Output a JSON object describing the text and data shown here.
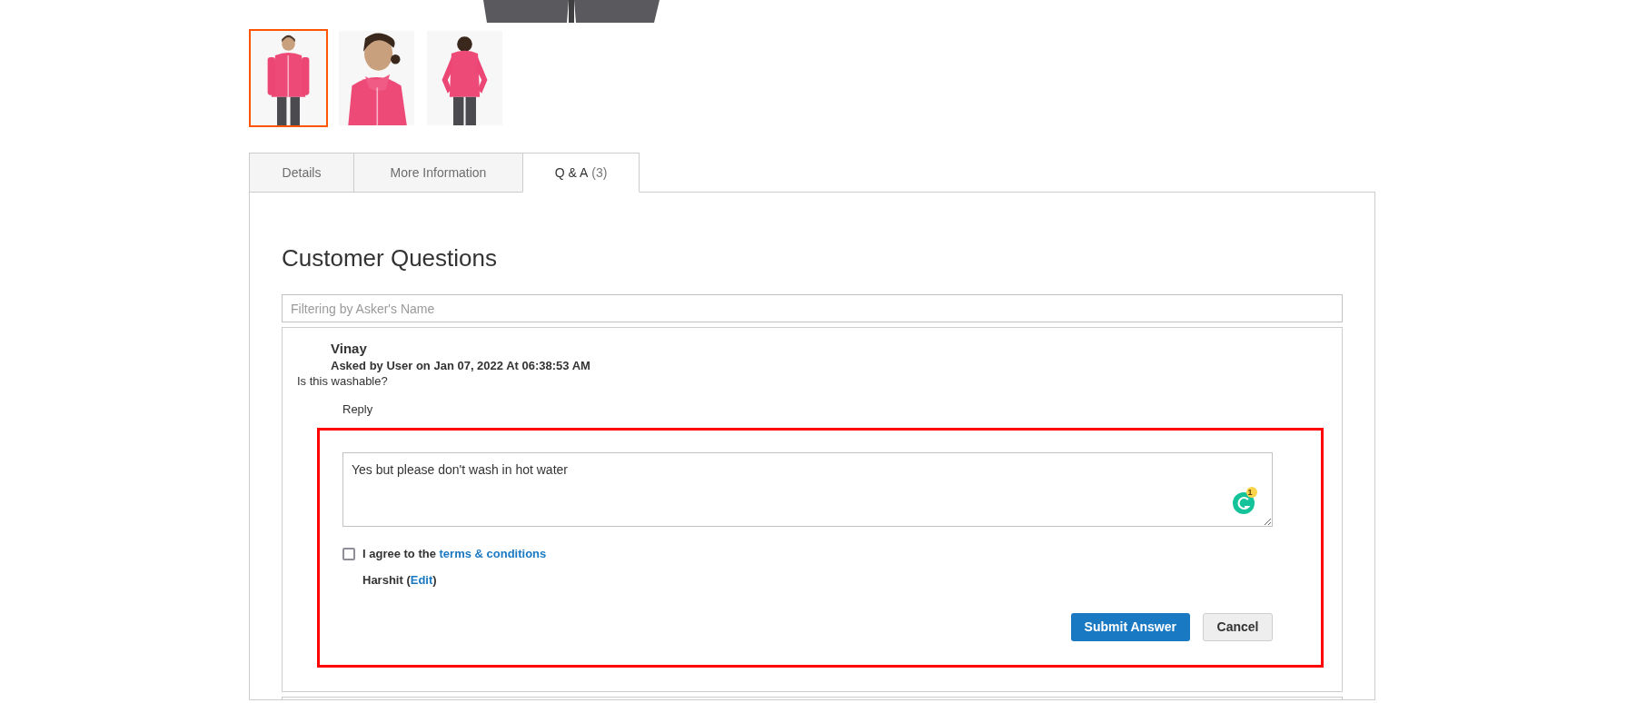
{
  "gallery": {
    "main_image": {
      "kind": "picture"
    },
    "thumbnails": [
      {
        "kind": "picture",
        "selected": true
      },
      {
        "kind": "picture",
        "selected": false
      },
      {
        "kind": "picture",
        "selected": false
      }
    ]
  },
  "tabs": [
    {
      "label": "Details",
      "selected": false
    },
    {
      "label": "More Information",
      "selected": false
    },
    {
      "label": "Q & A",
      "count": "(3)",
      "selected": true
    }
  ],
  "qa": {
    "heading": "Customer Questions",
    "filter": {
      "placeholder": "Filtering by Asker's Name"
    },
    "questions": [
      {
        "name": "Vinay",
        "meta": "Asked by User on Jan 07, 2022 At 06:38:53 AM",
        "text": "Is this washable?",
        "reply_link": "Reply",
        "reply_form": {
          "value": "Yes but please don't wash in hot water",
          "grammar_badge": "1",
          "agree_prefix": "I agree to the",
          "agree_link": "terms & conditions",
          "agree_checked": false,
          "user_prefix": "Harshit (",
          "user_link": "Edit",
          "user_suffix": ")",
          "submit": "Submit Answer",
          "cancel": "Cancel"
        }
      }
    ]
  }
}
